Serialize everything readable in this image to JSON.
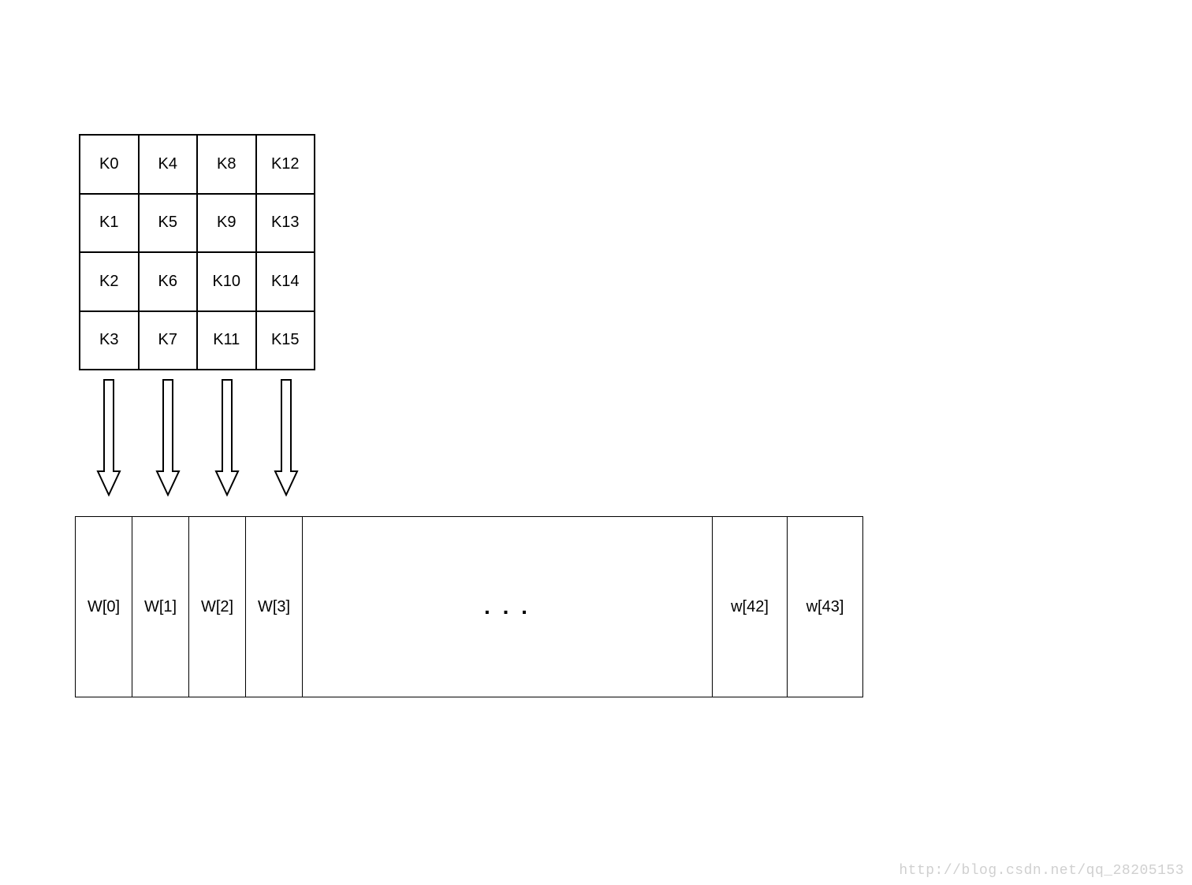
{
  "k_grid": {
    "rows": 4,
    "cols": 4,
    "cells_column_major": [
      [
        "K0",
        "K4",
        "K8",
        "K12"
      ],
      [
        "K1",
        "K5",
        "K9",
        "K13"
      ],
      [
        "K2",
        "K6",
        "K10",
        "K14"
      ],
      [
        "K3",
        "K7",
        "K11",
        "K15"
      ]
    ]
  },
  "arrows": {
    "count": 4,
    "direction": "down"
  },
  "w_row": {
    "leading": [
      "W[0]",
      "W[1]",
      "W[2]",
      "W[3]"
    ],
    "ellipsis": ". . .",
    "trailing": [
      "w[42]",
      "w[43]"
    ]
  },
  "watermark": "http://blog.csdn.net/qq_28205153"
}
